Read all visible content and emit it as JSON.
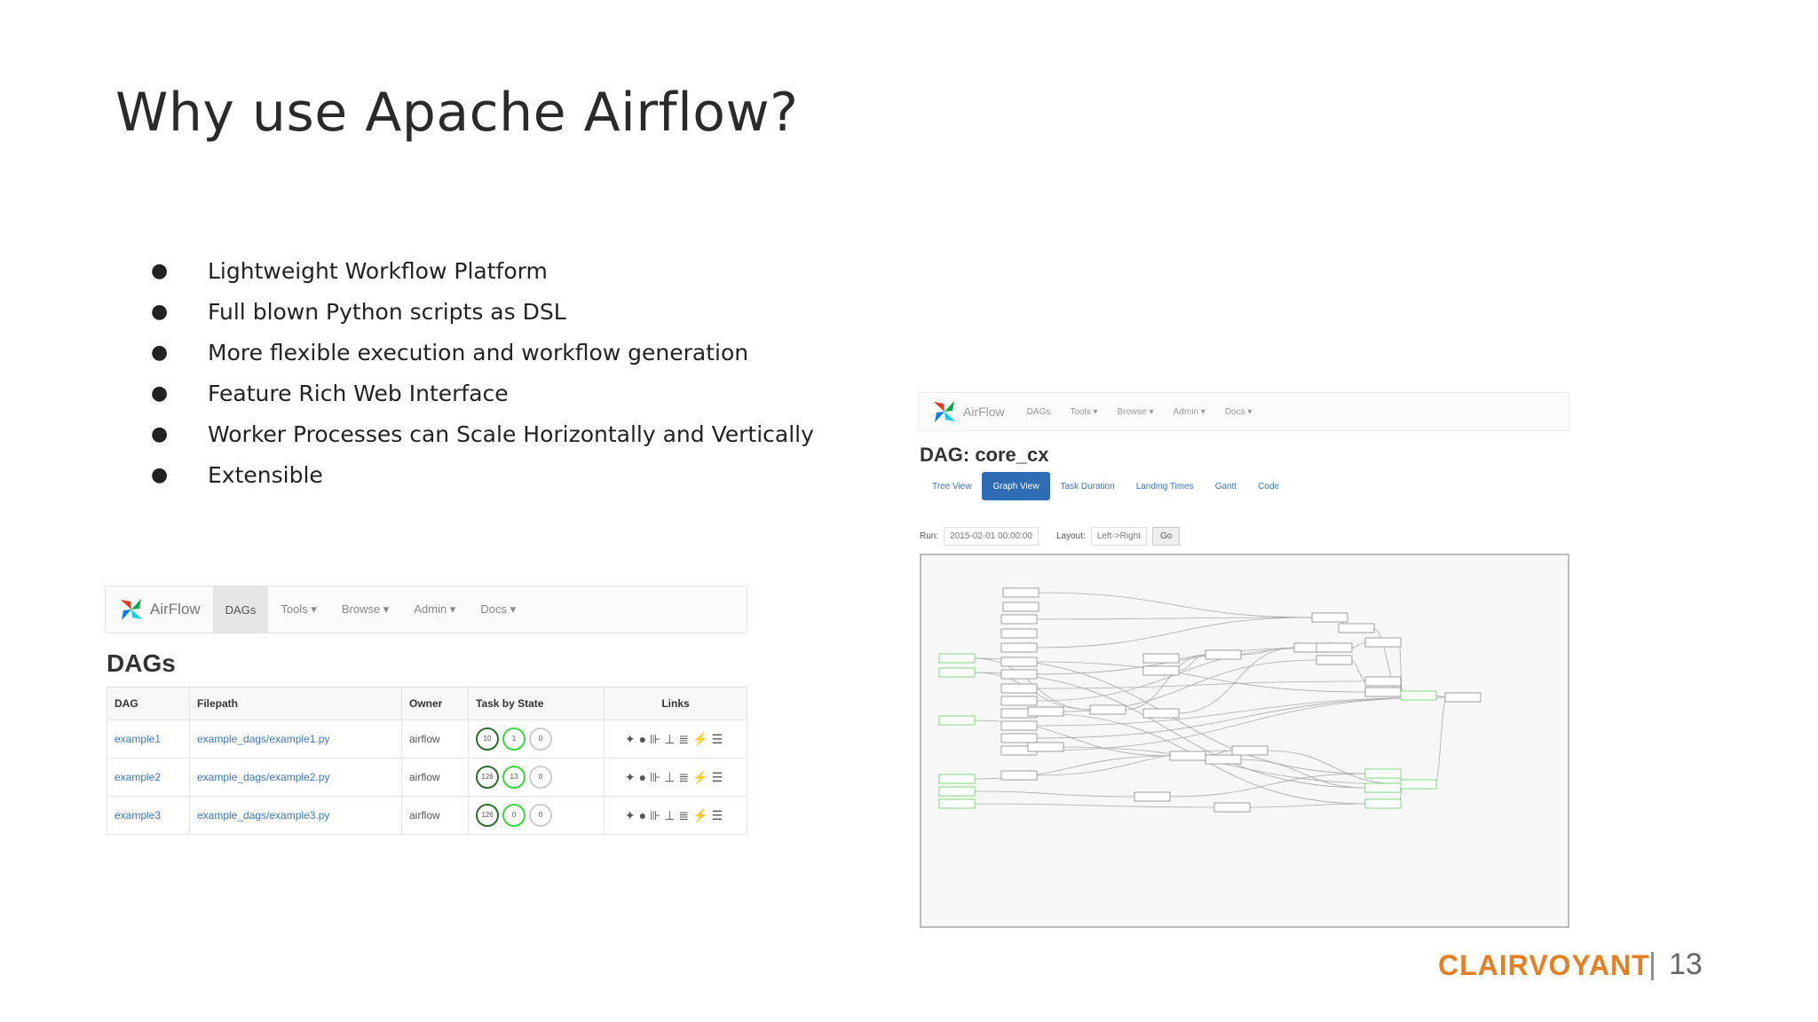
{
  "slide": {
    "title": "Why use Apache Airflow?",
    "bullets": [
      "Lightweight Workflow Platform",
      "Full blown Python scripts as DSL",
      "More flexible execution and workflow generation",
      "Feature Rich Web Interface",
      "Worker Processes can Scale Horizontally and Vertically",
      "Extensible"
    ],
    "bullet_glyph": "●"
  },
  "dags_screenshot": {
    "logo_text": "AirFlow",
    "nav": [
      "DAGs",
      "Tools ▾",
      "Browse ▾",
      "Admin ▾",
      "Docs ▾"
    ],
    "active_nav": "DAGs",
    "heading": "DAGs",
    "columns": [
      "DAG",
      "Filepath",
      "Owner",
      "Task by State",
      "Links"
    ],
    "rows": [
      {
        "dag": "example1",
        "filepath": "example_dags/example1.py",
        "owner": "airflow",
        "states": [
          "10",
          "1",
          "0"
        ]
      },
      {
        "dag": "example2",
        "filepath": "example_dags/example2.py",
        "owner": "airflow",
        "states": [
          "126",
          "13",
          "0"
        ]
      },
      {
        "dag": "example3",
        "filepath": "example_dags/example3.py",
        "owner": "airflow",
        "states": [
          "126",
          "0",
          "0"
        ]
      }
    ],
    "link_icons": "✦●⊪⊥≣⚡☰"
  },
  "graph_screenshot": {
    "logo_text": "AirFlow",
    "nav": [
      "DAGs",
      "Tools ▾",
      "Browse ▾",
      "Admin ▾",
      "Docs ▾"
    ],
    "dag_title": "DAG: core_cx",
    "tabs": [
      "Tree View",
      "Graph View",
      "Task Duration",
      "Landing Times",
      "Gantt",
      "Code"
    ],
    "active_tab": "Graph View",
    "run_label": "Run:",
    "run_value": "2015-02-01 00:00:00",
    "layout_label": "Layout:",
    "layout_value": "Left->Right",
    "go_label": "Go"
  },
  "footer": {
    "brand": "CLAIRVOYANT",
    "separator": "|",
    "page_number": "13",
    "brand_color": "#e67e22"
  }
}
